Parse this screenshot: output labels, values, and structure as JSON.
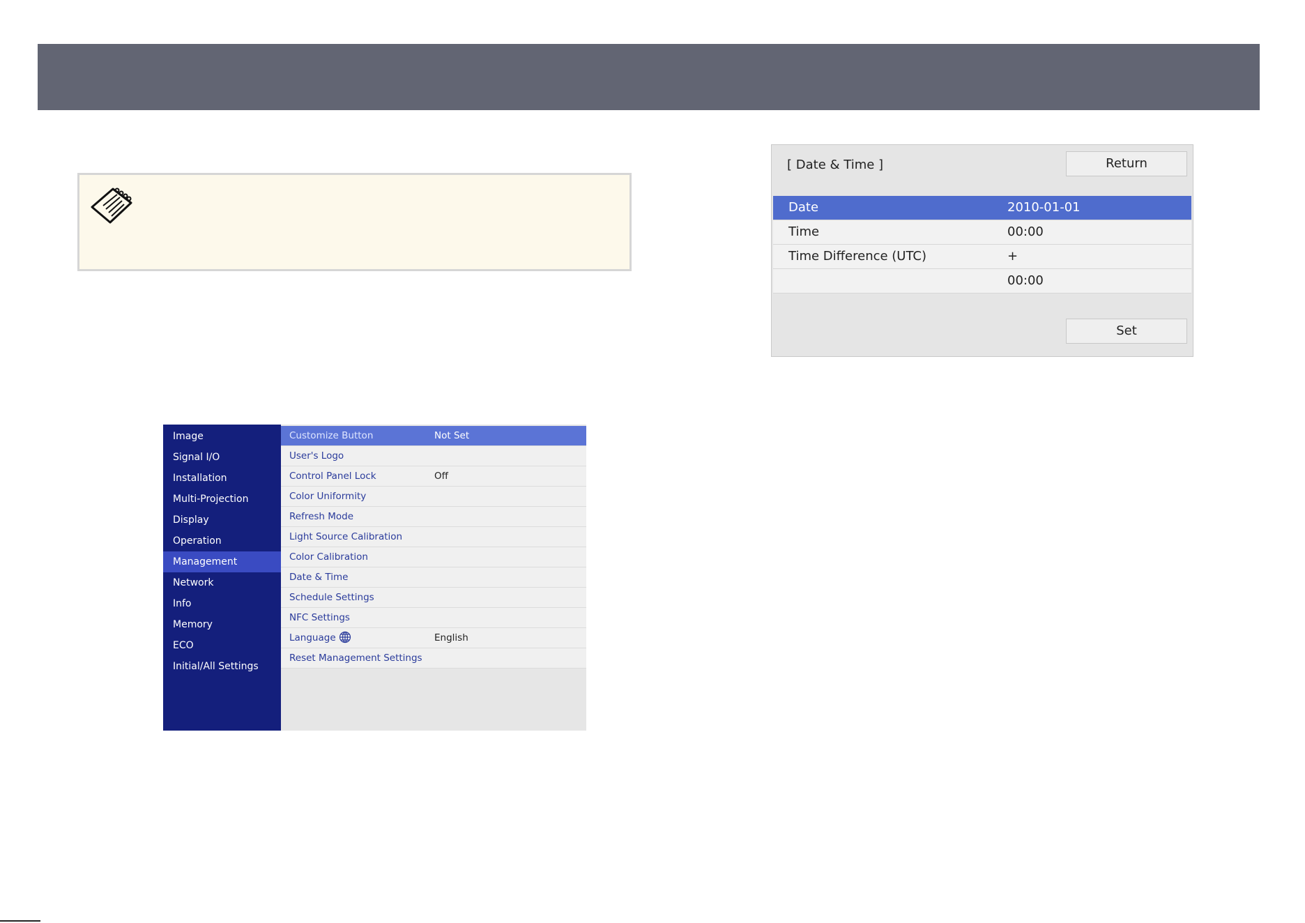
{
  "note": {
    "icon": "note-icon"
  },
  "menu": {
    "sidebar": [
      {
        "label": "Image"
      },
      {
        "label": "Signal I/O"
      },
      {
        "label": "Installation"
      },
      {
        "label": "Multi-Projection"
      },
      {
        "label": "Display"
      },
      {
        "label": "Operation"
      },
      {
        "label": "Management",
        "active": true
      },
      {
        "label": "Network"
      },
      {
        "label": "Info"
      },
      {
        "label": "Memory"
      },
      {
        "label": "ECO"
      },
      {
        "label": "Initial/All Settings"
      }
    ],
    "items": [
      {
        "label": "Customize Button",
        "value": "Not Set",
        "selected": true
      },
      {
        "label": "User's Logo",
        "value": ""
      },
      {
        "label": "Control Panel Lock",
        "value": "Off"
      },
      {
        "label": "Color Uniformity",
        "value": ""
      },
      {
        "label": "Refresh Mode",
        "value": ""
      },
      {
        "label": "Light Source Calibration",
        "value": ""
      },
      {
        "label": "Color Calibration",
        "value": ""
      },
      {
        "label": "Date & Time",
        "value": ""
      },
      {
        "label": "Schedule Settings",
        "value": ""
      },
      {
        "label": "NFC Settings",
        "value": ""
      },
      {
        "label": "Language",
        "value": "English",
        "icon": "globe-icon"
      },
      {
        "label": "Reset Management Settings",
        "value": ""
      }
    ]
  },
  "dialog": {
    "title": "[ Date & Time ]",
    "return_label": "Return",
    "set_label": "Set",
    "rows": [
      {
        "label": "Date",
        "value": "2010-01-01",
        "selected": true
      },
      {
        "label": "Time",
        "value": "00:00"
      },
      {
        "label": "Time Difference (UTC)",
        "value": "+"
      },
      {
        "label": "",
        "value": "00:00"
      }
    ]
  },
  "colors": {
    "banner": "#626573",
    "menu_sidebar": "#141f7c",
    "menu_active": "#3a4bc2",
    "menu_selected": "#5b74d6",
    "dialog_selected": "#4f6ccd",
    "note_bg": "#fdf9eb"
  }
}
